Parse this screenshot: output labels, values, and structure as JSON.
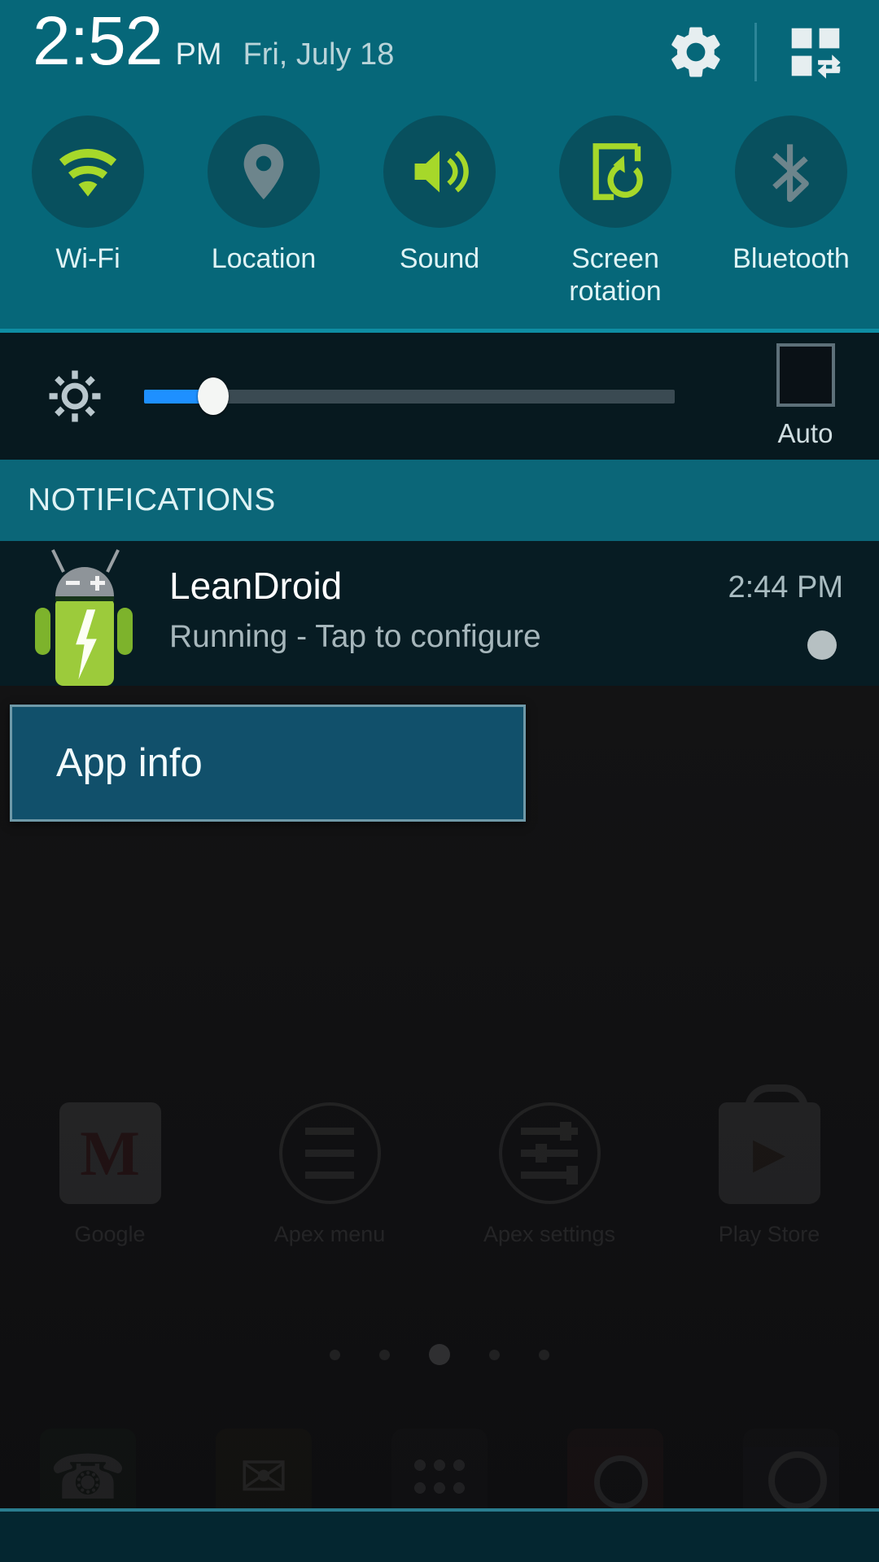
{
  "statusbar": {
    "time": "2:52",
    "ampm": "PM",
    "date": "Fri, July 18",
    "gear_icon": "gear-icon",
    "grid_icon": "quick-settings-edit-icon"
  },
  "quick_settings": {
    "toggles": [
      {
        "label": "Wi-Fi",
        "icon": "wifi-icon",
        "state": "on",
        "color": "#a6d82a"
      },
      {
        "label": "Location",
        "icon": "location-pin-icon",
        "state": "off",
        "color": "#6d858c"
      },
      {
        "label": "Sound",
        "icon": "speaker-icon",
        "state": "on",
        "color": "#a6d82a"
      },
      {
        "label": "Screen\nrotation",
        "icon": "screen-rotation-icon",
        "state": "on",
        "color": "#a6d82a"
      },
      {
        "label": "Bluetooth",
        "icon": "bluetooth-icon",
        "state": "off",
        "color": "#6d858c"
      }
    ],
    "toggle_labels": {
      "wifi": "Wi-Fi",
      "location": "Location",
      "sound": "Sound",
      "screen_rotation_line1": "Screen",
      "screen_rotation_line2": "rotation",
      "bluetooth": "Bluetooth"
    }
  },
  "brightness": {
    "icon": "brightness-icon",
    "value_percent": 13,
    "fill_color": "#1e90ff",
    "auto_label": "Auto",
    "auto_checked": false
  },
  "notifications": {
    "header": "NOTIFICATIONS",
    "items": [
      {
        "app_icon": "leandroid-robot-battery-icon",
        "title": "LeanDroid",
        "subtitle": "Running - Tap to configure",
        "time": "2:44 PM",
        "expand_indicator": "expand-dot-icon"
      }
    ]
  },
  "popup": {
    "label": "App info"
  },
  "home_screen": {
    "apps": [
      {
        "label": "Google",
        "icon": "google-gmail-icon"
      },
      {
        "label": "Apex menu",
        "icon": "apex-menu-icon"
      },
      {
        "label": "Apex settings",
        "icon": "apex-settings-icon"
      },
      {
        "label": "Play Store",
        "icon": "play-store-icon"
      }
    ],
    "page_dots": {
      "count": 5,
      "active_index": 2
    },
    "dock": [
      {
        "icon": "phone-icon"
      },
      {
        "icon": "messaging-icon"
      },
      {
        "icon": "app-drawer-icon"
      },
      {
        "icon": "browser-icon"
      },
      {
        "icon": "camera-icon"
      }
    ]
  },
  "theme": {
    "teal": "#066779",
    "teal_circle": "#08505e",
    "dark_navy": "#07191f",
    "notif_bg": "#071c23",
    "accent_green": "#a6d82a",
    "popup_bg": "#11506b"
  }
}
